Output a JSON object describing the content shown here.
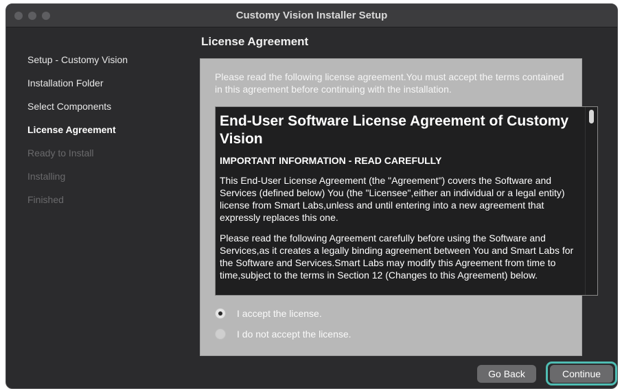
{
  "window": {
    "title": "Customy Vision Installer Setup"
  },
  "sidebar": {
    "steps": [
      {
        "label": "Setup - Customy Vision",
        "state": "done"
      },
      {
        "label": "Installation Folder",
        "state": "done"
      },
      {
        "label": "Select Components",
        "state": "done"
      },
      {
        "label": "License Agreement",
        "state": "current"
      },
      {
        "label": "Ready to Install",
        "state": "future"
      },
      {
        "label": "Installing",
        "state": "future"
      },
      {
        "label": "Finished",
        "state": "future"
      }
    ]
  },
  "page": {
    "title": "License Agreement",
    "intro": "Please read the following license agreement.You must accept the terms contained in this agreement before continuing with the installation."
  },
  "license": {
    "title": "End-User Software License Agreement of Customy Vision",
    "subtitle": "IMPORTANT INFORMATION - READ CAREFULLY",
    "para1": "This End-User License Agreement (the \"Agreement\") covers the Software and Services (defined below) You (the \"Licensee\",either an individual or a legal entity) license from Smart Labs,unless and until entering into a new agreement that expressly replaces this one.",
    "para2": "Please read the following Agreement carefully before using the Software and Services,as it creates a legally binding agreement between You and Smart Labs for the Software and Services.Smart Labs may modify this Agreement from time to time,subject to the terms in Section 12 (Changes to this Agreement) below."
  },
  "options": {
    "accept": {
      "label": "I accept the license.",
      "checked": true
    },
    "decline": {
      "label": "I do not accept the license.",
      "checked": false
    }
  },
  "buttons": {
    "back": "Go Back",
    "continue": "Continue"
  },
  "colors": {
    "focus_ring": "#4fbdb3",
    "window_bg": "#2b2b2d",
    "panel_bg": "#b8b8b8"
  }
}
